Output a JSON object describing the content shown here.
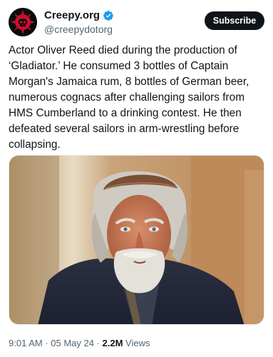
{
  "account": {
    "display_name": "Creepy.org",
    "handle": "@creepydotorg",
    "avatar_icon": "skull-logo-icon",
    "verified_icon": "verified-badge-icon",
    "verified_color": "#1d9bf0",
    "brand_color": "#c8102e"
  },
  "actions": {
    "subscribe_label": "Subscribe"
  },
  "tweet": {
    "text": "Actor Oliver Reed died during the production of ‘Gladiator.’ He consumed 3 bottles of Captain Morgan's Jamaica rum, 8 bottles of German beer, numerous cognacs after challenging sailors from HMS Cumberland to a drinking contest. He then defeated several sailors in arm-wrestling before collapsing."
  },
  "media": {
    "kind": "photo"
  },
  "meta": {
    "time": "9:01 AM",
    "separator1": " · ",
    "date": "05 May 24",
    "separator2": " · ",
    "views_count": "2.2M",
    "views_label": " Views"
  }
}
